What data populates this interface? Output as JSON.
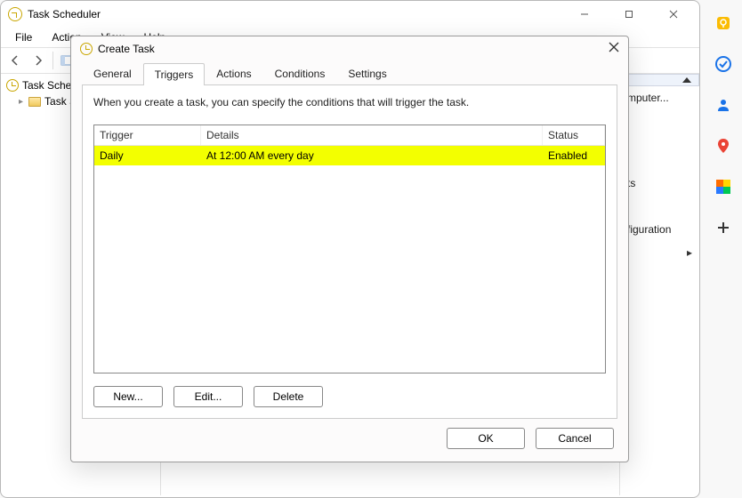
{
  "app": {
    "title": "Task Scheduler",
    "menus": [
      "File",
      "Action",
      "View",
      "Help"
    ]
  },
  "tree": {
    "root": "Task Scheduler",
    "child": "Task Scheduler"
  },
  "actions_panel": {
    "items": [
      "mputer...",
      "ts",
      "figuration"
    ]
  },
  "dialog": {
    "title": "Create Task",
    "tabs": [
      "General",
      "Triggers",
      "Actions",
      "Conditions",
      "Settings"
    ],
    "active_tab": 1,
    "description": "When you create a task, you can specify the conditions that will trigger the task.",
    "columns": {
      "trigger": "Trigger",
      "details": "Details",
      "status": "Status"
    },
    "rows": [
      {
        "trigger": "Daily",
        "details": "At 12:00 AM every day",
        "status": "Enabled",
        "selected": true
      }
    ],
    "buttons": {
      "new": "New...",
      "edit": "Edit...",
      "delete": "Delete"
    },
    "footer": {
      "ok": "OK",
      "cancel": "Cancel"
    }
  },
  "side_toolbar": {
    "icons": [
      "keep-icon",
      "check-icon",
      "person-icon",
      "maps-icon",
      "color-icon",
      "add-icon"
    ]
  }
}
